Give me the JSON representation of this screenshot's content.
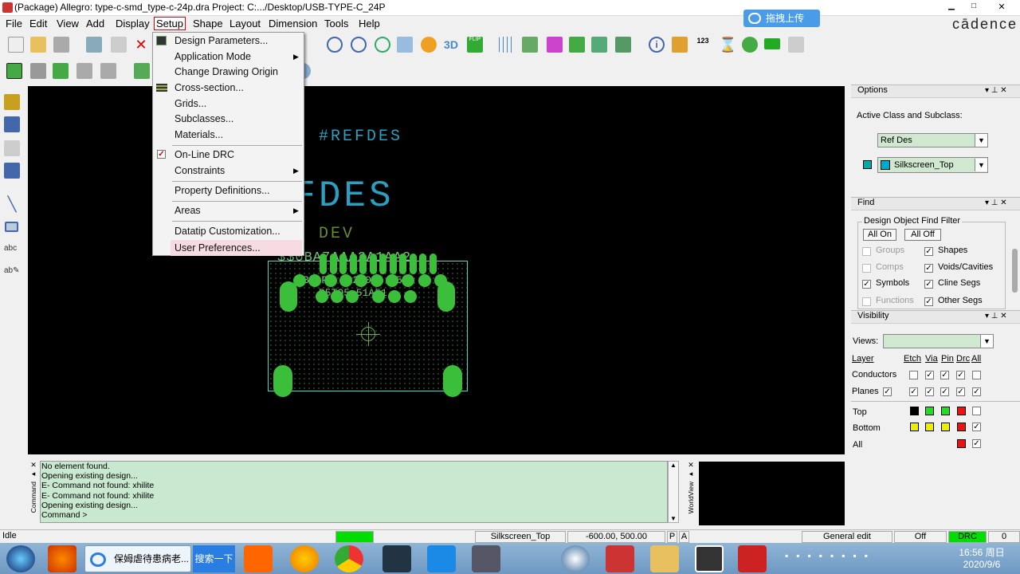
{
  "window": {
    "title": "(Package) Allegro: type-c-smd_type-c-24p.dra  Project: C:.../Desktop/USB-TYPE-C_24P",
    "brand": "cādence",
    "upload_label": "拖拽上传"
  },
  "menu": [
    "File",
    "Edit",
    "View",
    "Add",
    "Display",
    "Setup",
    "Shape",
    "Layout",
    "Dimension",
    "Tools",
    "Help"
  ],
  "setup_menu": {
    "items": [
      "Design Parameters...",
      "Application Mode",
      "Change Drawing Origin",
      "Cross-section...",
      "Grids...",
      "Subclasses...",
      "Materials...",
      "On-Line DRC",
      "Constraints",
      "Property Definitions...",
      "Areas",
      "Datatip Customization...",
      "User Preferences..."
    ],
    "online_drc_checked": true
  },
  "toolbar_labels": {
    "three_d": "3D",
    "flip": "FLIP",
    "count": "123"
  },
  "canvas": {
    "refdes_small": "#REFDES",
    "refdes_large": "REFDES",
    "dev": "DEV",
    "pad_text_1": "$$0BA7AAA2A1AA2",
    "pad_text_2": "BA1P2 B0200A4 B5",
    "pad_text_3": "B5TO5   51A51"
  },
  "options": {
    "header": "Options",
    "active_label": "Active Class and Subclass:",
    "class_value": "Ref Des",
    "subclass_value": "Silkscreen_Top",
    "subclass_color": "#00aacc"
  },
  "find": {
    "header": "Find",
    "group_label": "Design Object Find Filter",
    "all_on": "All On",
    "all_off": "All Off",
    "items": [
      {
        "label": "Groups",
        "checked": false,
        "enabled": false
      },
      {
        "label": "Shapes",
        "checked": true,
        "enabled": true
      },
      {
        "label": "Comps",
        "checked": false,
        "enabled": false
      },
      {
        "label": "Voids/Cavities",
        "checked": true,
        "enabled": true
      },
      {
        "label": "Symbols",
        "checked": true,
        "enabled": true
      },
      {
        "label": "Cline Segs",
        "checked": true,
        "enabled": true
      },
      {
        "label": "Functions",
        "checked": false,
        "enabled": false
      },
      {
        "label": "Other Segs",
        "checked": true,
        "enabled": true
      }
    ]
  },
  "visibility": {
    "header": "Visibility",
    "views_label": "Views:",
    "views_value": "",
    "columns": [
      "Layer",
      "Etch",
      "Via",
      "Pin",
      "Drc",
      "All"
    ],
    "rows": [
      {
        "label": "Conductors"
      },
      {
        "label": "Planes"
      }
    ],
    "layers": [
      {
        "label": "Top",
        "colors": [
          "#000000",
          "#22dd22",
          "#22dd22",
          "#ee1111"
        ]
      },
      {
        "label": "Bottom",
        "colors": [
          "#eeee00",
          "#eeee00",
          "#eeee00",
          "#ee1111"
        ]
      },
      {
        "label": "All",
        "colors": [
          "#ee1111"
        ]
      }
    ]
  },
  "command": {
    "lines": [
      "No element found.",
      "Opening existing design...",
      "E- Command not found: xhilite",
      "E- Command not found: xhilite",
      "Opening existing design...",
      "Command >"
    ],
    "side_label": "Command",
    "world_label": "WorldView"
  },
  "status": {
    "mode": "Idle",
    "subclass": "Silkscreen_Top",
    "coords": "-600.00, 500.00",
    "p": "P",
    "a": "A",
    "edit": "General edit",
    "off": "Off",
    "drc": "DRC",
    "count": "0"
  },
  "taskbar": {
    "browser_tab": "保姆虐待患病老...",
    "search_btn": "搜索一下",
    "time": "16:56 周日",
    "date": "2020/9/6"
  }
}
